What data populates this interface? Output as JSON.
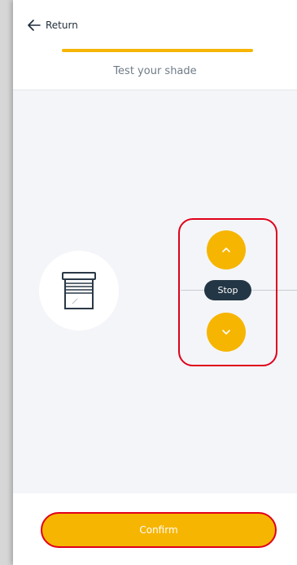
{
  "header": {
    "return_label": "Return",
    "title": "Test your shade",
    "progress_fraction": 1.0
  },
  "controls": {
    "up_icon": "chevron-up-icon",
    "stop_label": "Stop",
    "down_icon": "chevron-down-icon"
  },
  "device": {
    "icon": "roller-shade-icon"
  },
  "footer": {
    "confirm_label": "Confirm"
  },
  "colors": {
    "accent": "#f6b500",
    "stop_button": "#233645",
    "highlight_border": "#e0001b",
    "background": "#f4f5f8"
  }
}
